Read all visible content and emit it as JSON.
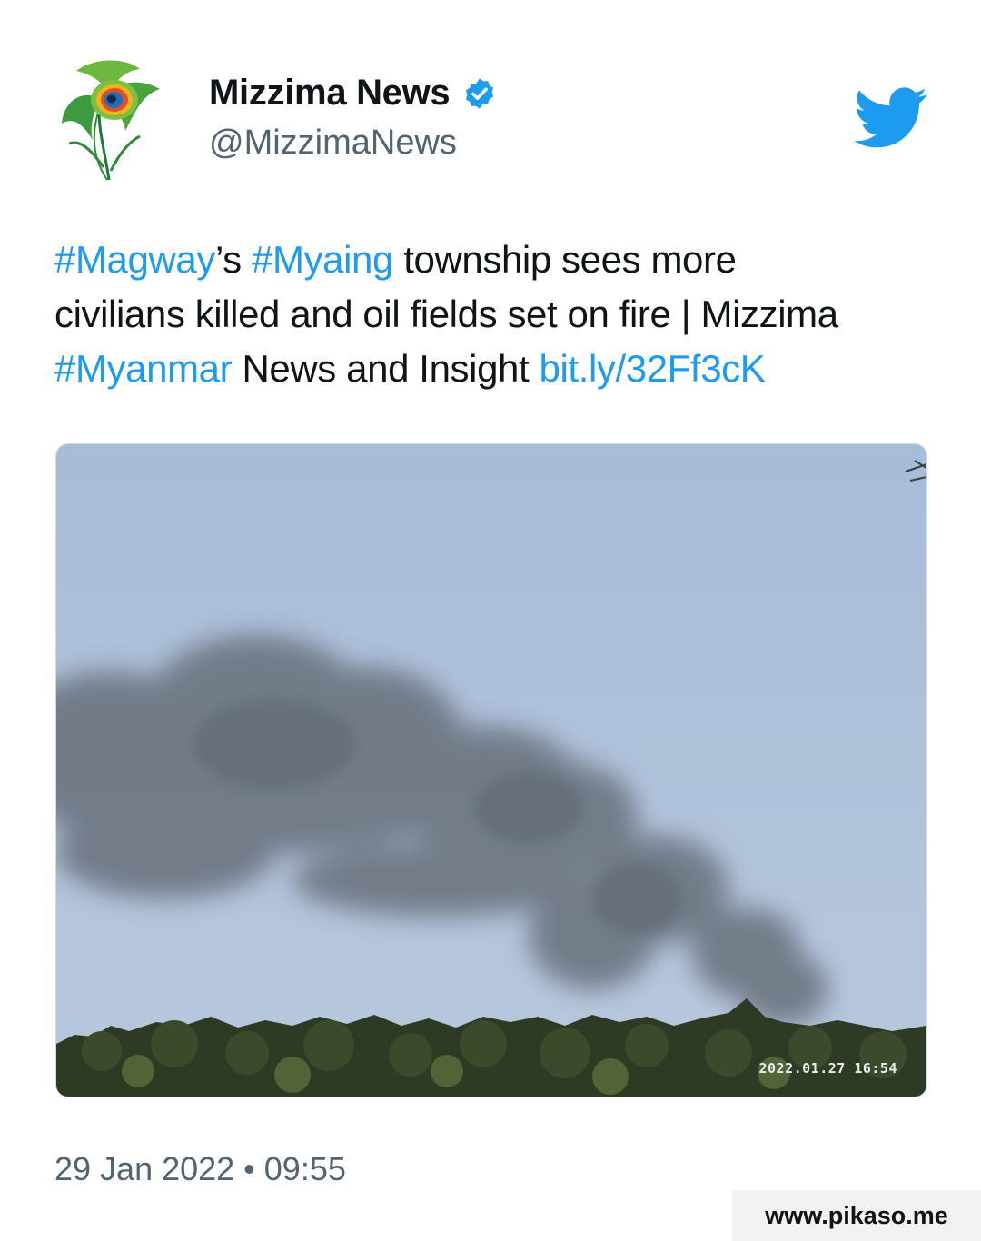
{
  "author": {
    "display_name": "Mizzima News",
    "handle": "@MizzimaNews",
    "verified_icon": "verified-badge-icon",
    "avatar_icon": "peacock-feather-logo"
  },
  "platform_icon": "twitter-bird-icon",
  "tweet": {
    "segments": {
      "magway_tag": "#Magway",
      "possessive": "’s ",
      "myaing_tag": "#Myaing",
      "text_1": " township sees more",
      "text_2": "civilians killed and oil fields set on fire | Mizzima",
      "myanmar_tag": "#Myanmar",
      "text_3": " News and Insight ",
      "short_link": "bit.ly/32Ff3cK"
    }
  },
  "media": {
    "camera_timestamp": "2022.01.27 16:54"
  },
  "timestamp": "29 Jan 2022 • 09:55",
  "watermark": "www.pikaso.me",
  "colors": {
    "link": "#1d9bf0",
    "text": "#0f1419",
    "secondary_text": "#536471",
    "verified": "#1d9bf0",
    "twitter_brand": "#1d9bf0"
  }
}
